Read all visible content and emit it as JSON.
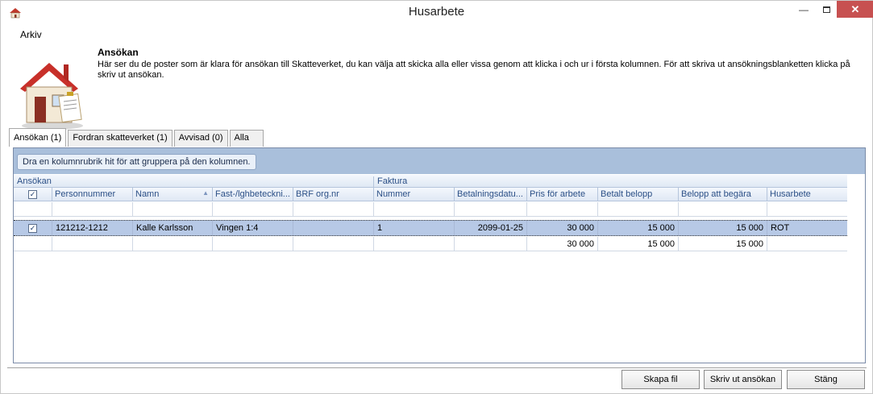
{
  "window": {
    "title": "Husarbete"
  },
  "menu": {
    "arkiv": "Arkiv"
  },
  "header": {
    "title": "Ansökan",
    "description": "Här ser du de poster som är klara för ansökan till Skatteverket, du kan välja att skicka alla eller vissa genom att klicka i och ur i första kolumnen. För att skriva ut ansökningsblanketten klicka på skriv ut ansökan."
  },
  "tabs": [
    {
      "label": "Ansökan (1)",
      "active": true
    },
    {
      "label": "Fordran skatteverket (1)",
      "active": false
    },
    {
      "label": "Avvisad (0)",
      "active": false
    },
    {
      "label": "Alla",
      "active": false
    }
  ],
  "grid": {
    "group_hint": "Dra en kolumnrubrik hit för att gruppera på den kolumnen.",
    "bands": {
      "ansokan": "Ansökan",
      "faktura": "Faktura"
    },
    "headers": {
      "check": "✓",
      "personnummer": "Personnummer",
      "namn": "Namn",
      "fastighet": "Fast-/lghbeteckni...",
      "brf": "BRF org.nr",
      "nummer": "Nummer",
      "betalningsdatum": "Betalningsdatu...",
      "pris": "Pris för arbete",
      "betalt": "Betalt belopp",
      "begara": "Belopp att begära",
      "husarbete": "Husarbete"
    },
    "rows": [
      {
        "check": "✓",
        "personnummer": "121212-1212",
        "namn": "Kalle Karlsson",
        "fastighet": "Vingen 1:4",
        "brf": "",
        "nummer": "1",
        "betalningsdatum": "2099-01-25",
        "pris": "30 000",
        "betalt": "15 000",
        "begara": "15 000",
        "husarbete": "ROT"
      }
    ],
    "totals": {
      "pris": "30 000",
      "betalt": "15 000",
      "begara": "15 000"
    }
  },
  "buttons": {
    "skapa_fil": "Skapa fil",
    "skriv_ut": "Skriv ut ansökan",
    "stang": "Stäng"
  },
  "colors": {
    "group_area": "#a9bfdb",
    "header_text": "#2b4f86",
    "selected_row": "#b7c9e6",
    "close_button": "#c75050"
  }
}
